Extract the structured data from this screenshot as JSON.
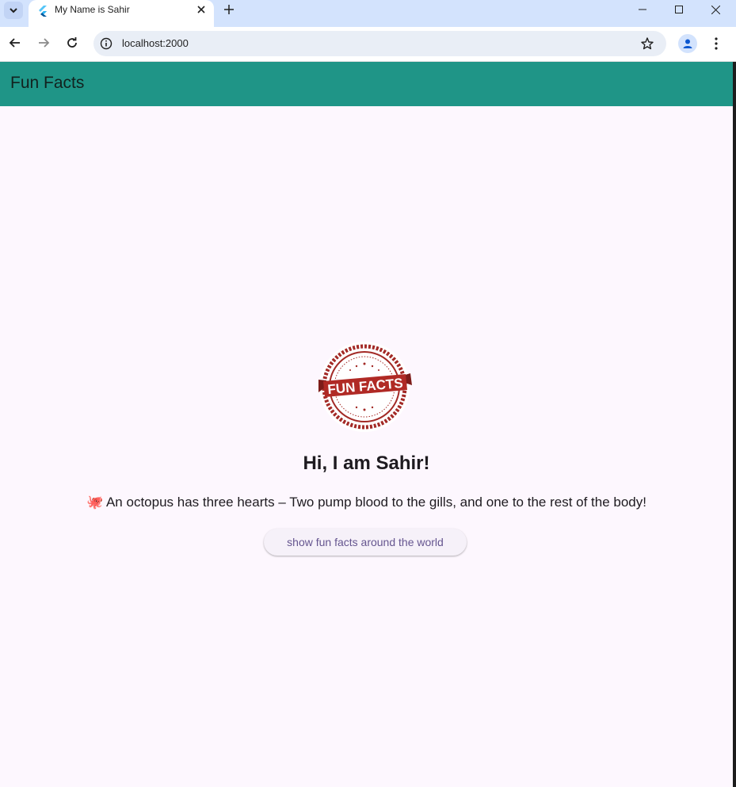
{
  "browser": {
    "tab_title": "My Name is Sahir",
    "url": "localhost:2000"
  },
  "app": {
    "title": "Fun Facts",
    "badge_text": "FUN FACTS",
    "greeting": "Hi, I am Sahir!",
    "fact_emoji": "🐙",
    "fact_text": "An octopus has three hearts – Two pump blood to the gills, and one to the rest of the body!",
    "button_label": "show fun facts around the world"
  },
  "colors": {
    "appbar": "#1f9587",
    "background": "#fdf7fe",
    "badge_red": "#a32a26",
    "button_text": "#65558f"
  }
}
